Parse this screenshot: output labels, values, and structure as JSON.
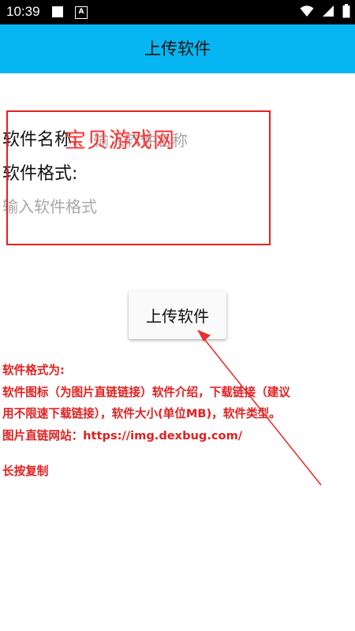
{
  "status_bar": {
    "time": "10:39",
    "notification_glyph": "A"
  },
  "app_bar": {
    "title": "上传软件"
  },
  "form": {
    "name_label": "软件名称:",
    "name_placeholder": "输入软件名称",
    "format_label": "软件格式:",
    "format_placeholder": "输入软件格式"
  },
  "watermark": "宝贝游戏网",
  "upload_button": {
    "label": "上传软件"
  },
  "info": {
    "line1": "软件格式为:",
    "line2": "软件图标（为图片直链链接）软件介绍，下载链接（建议",
    "line3": "用不限速下载链接），软件大小(单位MB)，软件类型。",
    "line4": "图片直链网站：https://img.dexbug.com/",
    "line5": "长按复制"
  },
  "colors": {
    "accent": "#06b6f2",
    "annotation": "#e52020"
  }
}
